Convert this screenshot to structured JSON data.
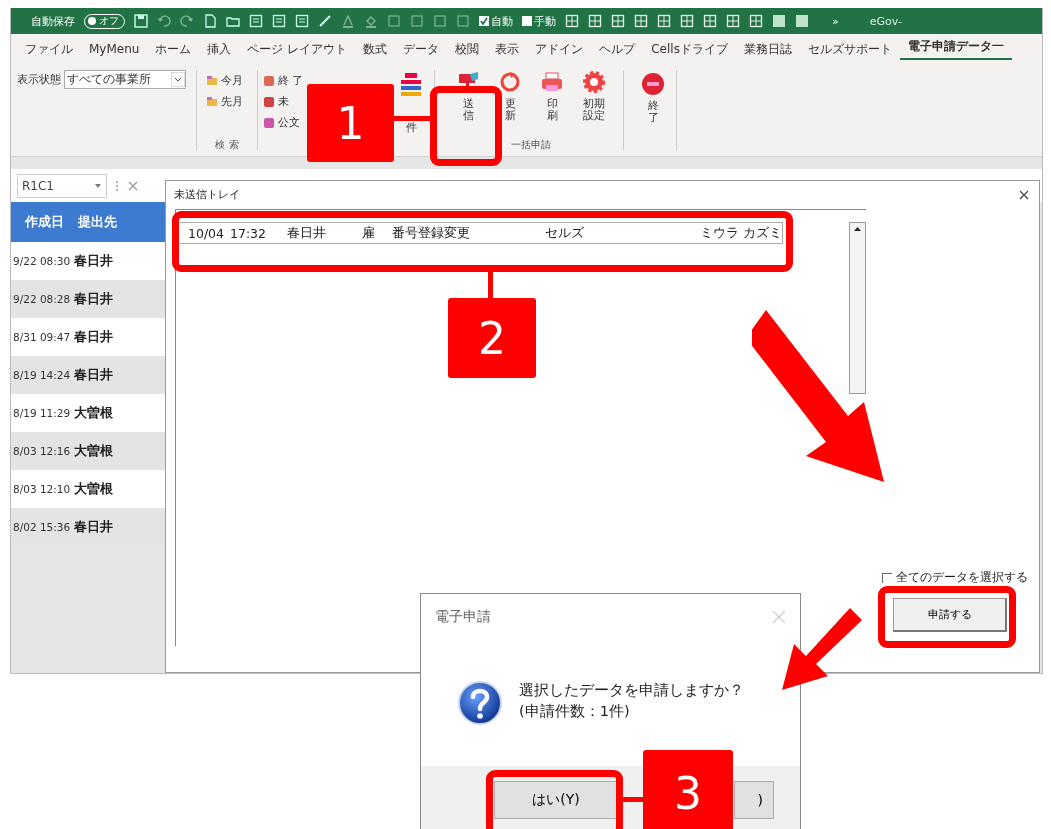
{
  "quick_access": {
    "autosave_label": "自動保存",
    "autosave_toggle": {
      "label": "オフ",
      "on": false
    },
    "checks": [
      {
        "label": "自動",
        "checked": true
      },
      {
        "label": "手動",
        "checked": false
      }
    ],
    "more": "»",
    "cut_title": "eGov-"
  },
  "ribbon_tabs": [
    {
      "label": "ファイル",
      "selected": false
    },
    {
      "label": "MyMenu",
      "selected": false
    },
    {
      "label": "ホーム",
      "selected": false
    },
    {
      "label": "挿入",
      "selected": false
    },
    {
      "label": "ページ レイアウト",
      "selected": false
    },
    {
      "label": "数式",
      "selected": false
    },
    {
      "label": "データ",
      "selected": false
    },
    {
      "label": "校閲",
      "selected": false
    },
    {
      "label": "表示",
      "selected": false
    },
    {
      "label": "アドイン",
      "selected": false
    },
    {
      "label": "ヘルプ",
      "selected": false
    },
    {
      "label": "Cellsドライブ",
      "selected": false
    },
    {
      "label": "業務日誌",
      "selected": false
    },
    {
      "label": "セルズサポート",
      "selected": false
    },
    {
      "label": "電子申請データ一",
      "selected": true
    }
  ],
  "ribbon": {
    "filter_label": "表示状態",
    "filter_value": "すべての事業所",
    "search_items": [
      "今月",
      "先月"
    ],
    "status_items": [
      "終 了",
      "未",
      "公文"
    ],
    "search_group": "検 索",
    "all_button": "件",
    "actions": [
      {
        "label": "送信",
        "kind": "send"
      },
      {
        "label": "更新",
        "kind": "refresh"
      },
      {
        "label": "印刷",
        "kind": "print"
      },
      {
        "label": "初期設定",
        "kind": "settings"
      }
    ],
    "batch_group": "一括申請",
    "exit_button": "終了"
  },
  "name_box": "R1C1",
  "sheet": {
    "columns": [
      "作成日",
      "提出先"
    ],
    "rows": [
      [
        "9/22 08:30",
        "春日井"
      ],
      [
        "9/22 08:28",
        "春日井"
      ],
      [
        "8/31 09:47",
        "春日井"
      ],
      [
        "8/19 14:24",
        "春日井"
      ],
      [
        "8/19 11:29",
        "大曽根"
      ],
      [
        "8/03 12:16",
        "大曽根"
      ],
      [
        "8/03 12:10",
        "大曽根"
      ],
      [
        "8/02 15:36",
        "春日井"
      ]
    ]
  },
  "tray": {
    "title": "未送信トレイ",
    "rows": [
      {
        "cells": [
          "10/04",
          "17:32",
          "春日井",
          "雇",
          "番号登録変更",
          "セルズ",
          "ミウラ カズミ"
        ],
        "selected": false
      }
    ],
    "select_all": {
      "label": "全てのデータを選択する",
      "checked": false
    },
    "submit_button": "申請する"
  },
  "message_box": {
    "title": "電子申請",
    "lines": [
      "選択したデータを申請しますか？",
      "(申請件数：1件)"
    ],
    "buttons": [
      "はい(Y)",
      ")"
    ]
  },
  "annotations": [
    {
      "label": "1"
    },
    {
      "label": "2"
    },
    {
      "label": "3"
    }
  ]
}
